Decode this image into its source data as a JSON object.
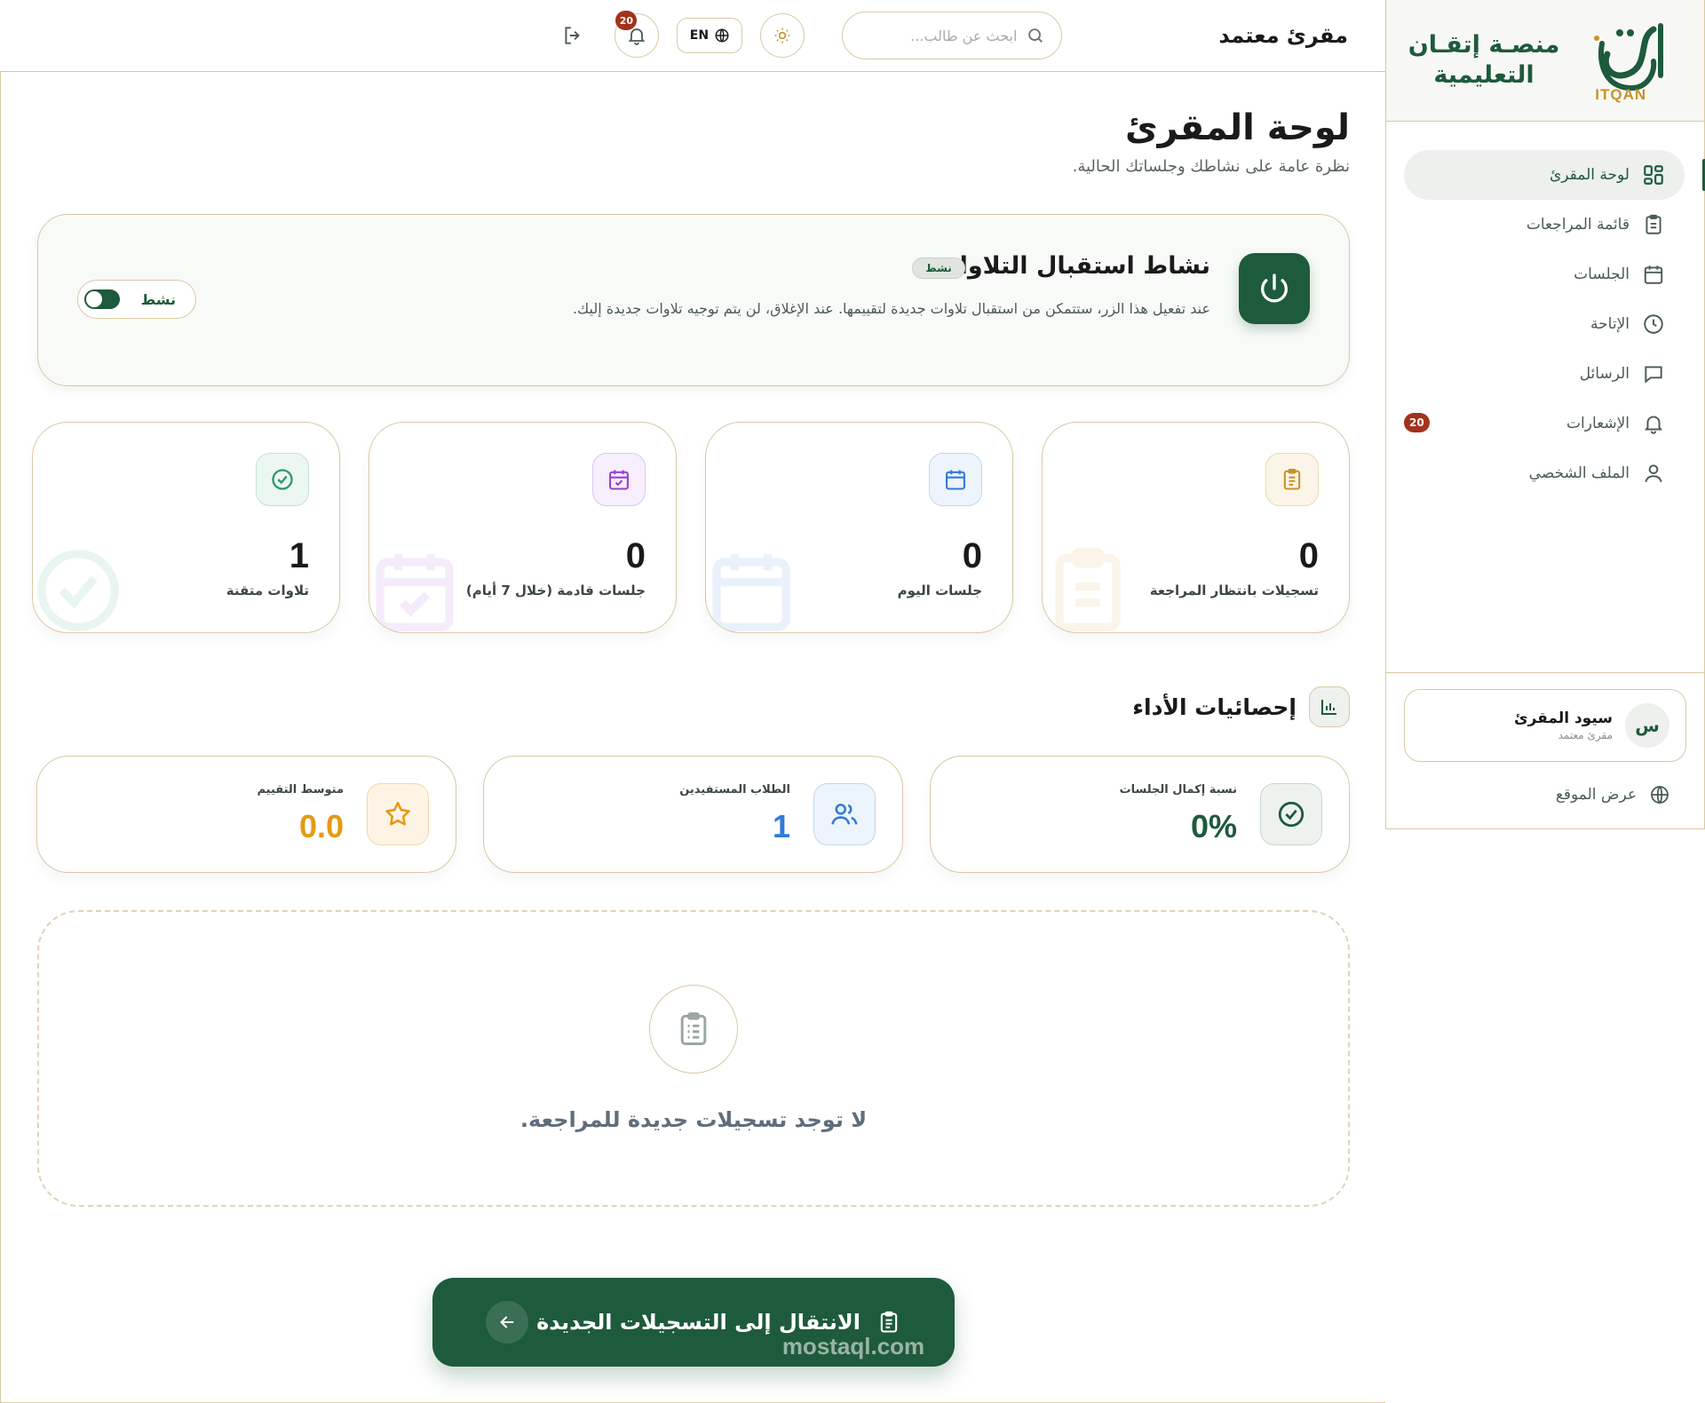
{
  "brand": {
    "name_line1": "منصـة إتقـان",
    "name_line2": "التعليمية",
    "logo_label": "ITQAN",
    "logo_glyph": "إتقان"
  },
  "sidebar": {
    "items": [
      {
        "label": "لوحة المقرئ",
        "icon": "dashboard-icon"
      },
      {
        "label": "قائمة المراجعات",
        "icon": "clipboard-icon"
      },
      {
        "label": "الجلسات",
        "icon": "calendar-icon"
      },
      {
        "label": "الإتاحة",
        "icon": "clock-icon"
      },
      {
        "label": "الرسائل",
        "icon": "message-icon"
      },
      {
        "label": "الإشعارات",
        "icon": "bell-icon",
        "badge": "20"
      },
      {
        "label": "الملف الشخصي",
        "icon": "user-icon"
      }
    ],
    "user": {
      "initial": "س",
      "name": "سيود المقرئ",
      "role": "مقرئ معتمد"
    },
    "site_link": "عرض الموقع"
  },
  "topbar": {
    "title": "مقرئ معتمد",
    "search_placeholder": "ابحث عن طالب...",
    "lang": "EN",
    "notif_count": "20"
  },
  "page": {
    "title": "لوحة المقرئ",
    "subtitle": "نظرة عامة على نشاطك وجلساتك الحالية."
  },
  "activity": {
    "title": "نشاط استقبال التلاوات",
    "pill": "نشط",
    "desc": "عند تفعيل هذا الزر، ستتمكن من استقبال تلاوات جديدة لتقييمها. عند الإغلاق، لن يتم توجيه تلاوات جديدة إليك.",
    "toggle_label": "نشط",
    "toggle_on": true
  },
  "stats": [
    {
      "value": "0",
      "label": "تسجيلات بانتظار المراجعة",
      "color": "#c8922a"
    },
    {
      "value": "0",
      "label": "جلسات اليوم",
      "color": "#2f7ad9"
    },
    {
      "value": "0",
      "label": "جلسات قادمة (خلال 7 أيام)",
      "color": "#9b3fd1"
    },
    {
      "value": "1",
      "label": "تلاوات متقنة",
      "color": "#2a9a6a"
    }
  ],
  "performance": {
    "title": "إحصائيات الأداء",
    "cards": [
      {
        "label": "نسبة إكمال الجلسات",
        "value": "0%",
        "color": "#1e5a3c"
      },
      {
        "label": "الطلاب المستفيدين",
        "value": "1",
        "color": "#2f7ad9"
      },
      {
        "label": "متوسط التقييم",
        "value": "0.0",
        "color": "#e59a12"
      }
    ]
  },
  "empty": {
    "text": "لا توجد تسجيلات جديدة للمراجعة."
  },
  "cta": {
    "label": "الانتقال إلى التسجيلات الجديدة"
  },
  "watermark": {
    "text": "mostaql.com"
  }
}
